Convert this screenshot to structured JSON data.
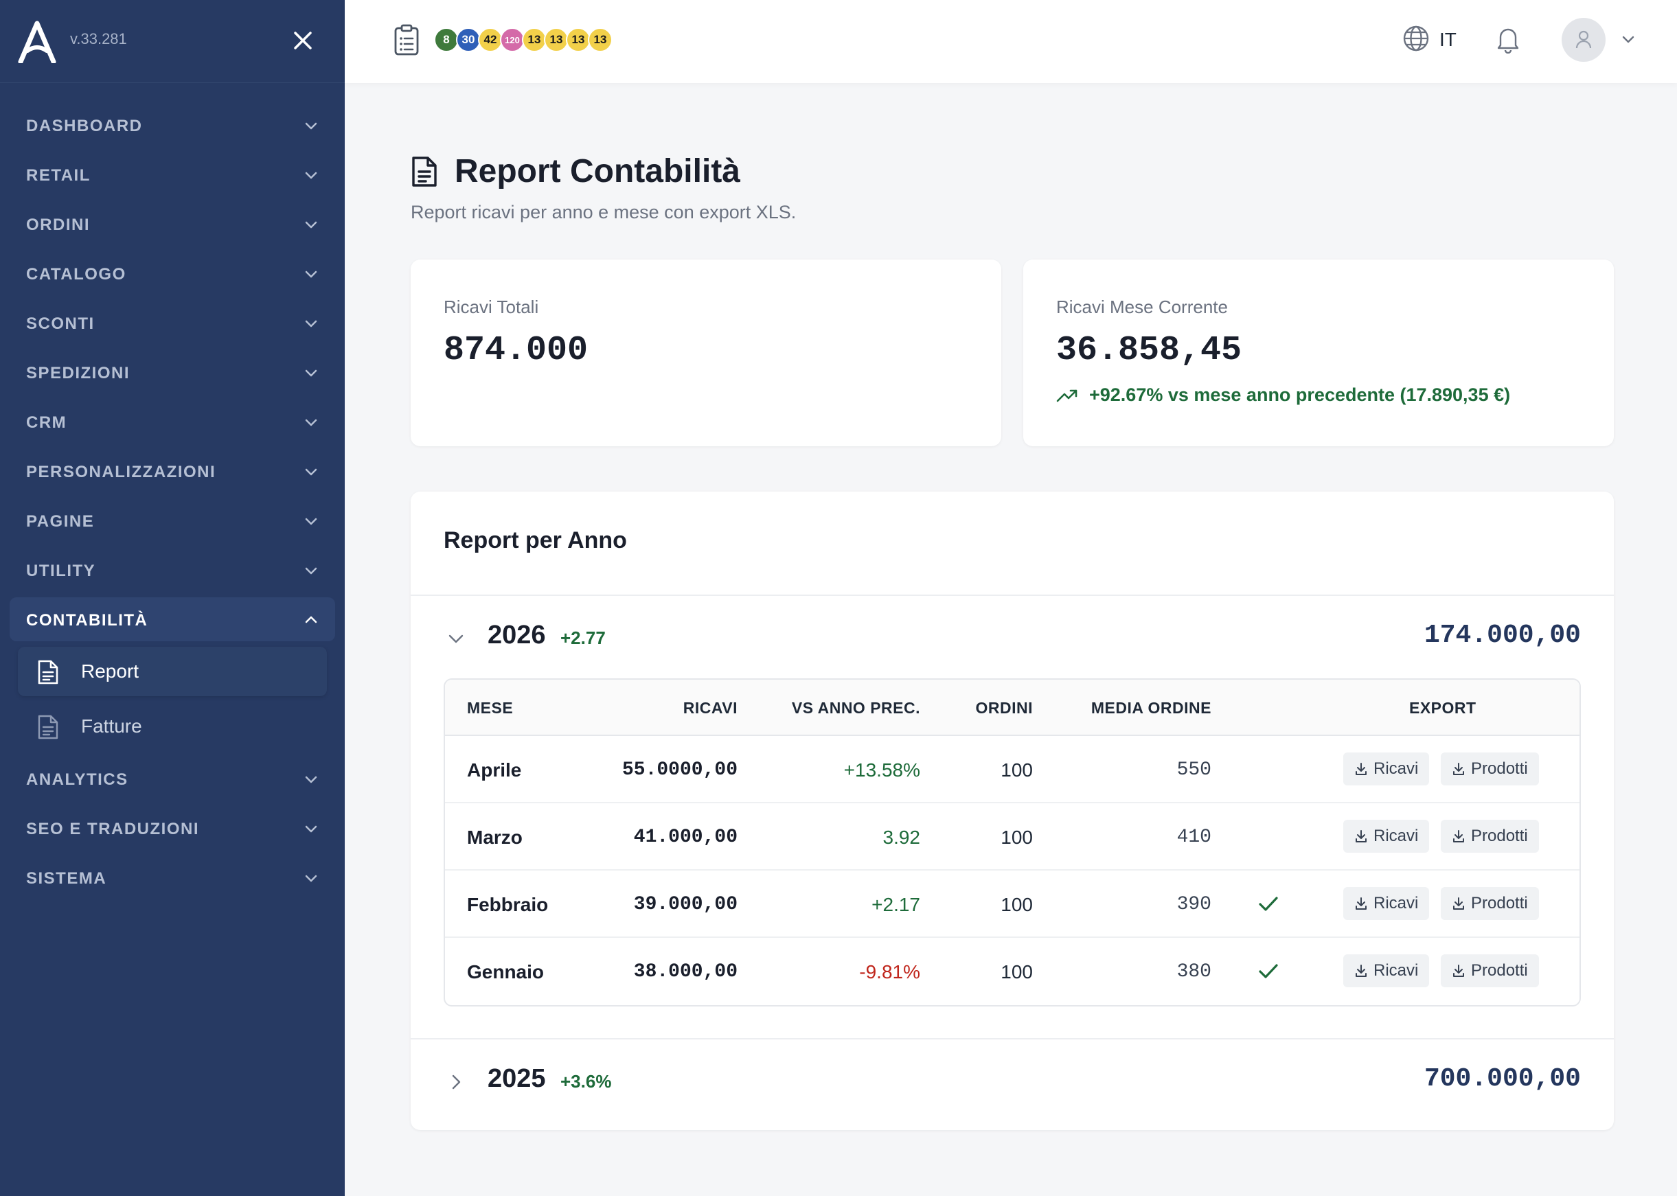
{
  "app": {
    "version": "v.33.281"
  },
  "sidebar": {
    "items": [
      {
        "label": "DASHBOARD"
      },
      {
        "label": "RETAIL"
      },
      {
        "label": "ORDINI"
      },
      {
        "label": "CATALOGO"
      },
      {
        "label": "SCONTI"
      },
      {
        "label": "SPEDIZIONI"
      },
      {
        "label": "CRM"
      },
      {
        "label": "PERSONALIZZAZIONI"
      },
      {
        "label": "PAGINE"
      },
      {
        "label": "UTILITY"
      },
      {
        "label": "CONTABILITÀ",
        "expanded": true,
        "children": [
          {
            "label": "Report",
            "active": true
          },
          {
            "label": "Fatture"
          }
        ]
      },
      {
        "label": "ANALYTICS"
      },
      {
        "label": "SEO E TRADUZIONI"
      },
      {
        "label": "SISTEMA"
      }
    ]
  },
  "topbar": {
    "badges": [
      {
        "value": "8",
        "color": "#3f7a3c",
        "text_color": "#ffffff"
      },
      {
        "value": "30",
        "color": "#2f5fb8",
        "text_color": "#ffffff"
      },
      {
        "value": "42",
        "color": "#f2d04a",
        "text_color": "#1a1a1a"
      },
      {
        "value": "120",
        "color": "#d46aa8",
        "text_color": "#ffffff"
      },
      {
        "value": "13",
        "color": "#f2d04a",
        "text_color": "#1a1a1a"
      },
      {
        "value": "13",
        "color": "#f2d04a",
        "text_color": "#1a1a1a"
      },
      {
        "value": "13",
        "color": "#f2d04a",
        "text_color": "#1a1a1a"
      },
      {
        "value": "13",
        "color": "#f2d04a",
        "text_color": "#1a1a1a"
      }
    ],
    "language": "IT"
  },
  "page": {
    "title": "Report Contabilità",
    "subtitle": "Report ricavi per anno e mese con export XLS."
  },
  "stats": {
    "total": {
      "label": "Ricavi Totali",
      "value": "874.000"
    },
    "current": {
      "label": "Ricavi Mese Corrente",
      "value": "36.858,45",
      "trend": "+92.67% vs mese anno precedente (17.890,35 €)"
    }
  },
  "report": {
    "title": "Report per Anno",
    "columns": {
      "month": "MESE",
      "revenue": "RICAVI",
      "vs": "VS ANNO PREC.",
      "orders": "ORDINI",
      "avg": "MEDIA ORDINE",
      "export": "EXPORT"
    },
    "export_buttons": {
      "revenue": "Ricavi",
      "products": "Prodotti"
    },
    "years": [
      {
        "year": "2026",
        "delta": "+2.77",
        "total": "174.000,00",
        "expanded": true,
        "rows": [
          {
            "month": "Aprile",
            "revenue": "55.0000,00",
            "vs": "+13.58%",
            "vs_sign": "pos",
            "orders": "100",
            "avg": "550",
            "checked": false
          },
          {
            "month": "Marzo",
            "revenue": "41.000,00",
            "vs": "3.92",
            "vs_sign": "pos",
            "orders": "100",
            "avg": "410",
            "checked": false
          },
          {
            "month": "Febbraio",
            "revenue": "39.000,00",
            "vs": "+2.17",
            "vs_sign": "pos",
            "orders": "100",
            "avg": "390",
            "checked": true
          },
          {
            "month": "Gennaio",
            "revenue": "38.000,00",
            "vs": "-9.81%",
            "vs_sign": "neg",
            "orders": "100",
            "avg": "380",
            "checked": true
          }
        ]
      },
      {
        "year": "2025",
        "delta": "+3.6%",
        "total": "700.000,00",
        "expanded": false
      }
    ]
  },
  "colors": {
    "sidebar_bg": "#273a63",
    "positive": "#1e6b3a",
    "negative": "#c0261c",
    "accent_dark": "#24365d"
  }
}
